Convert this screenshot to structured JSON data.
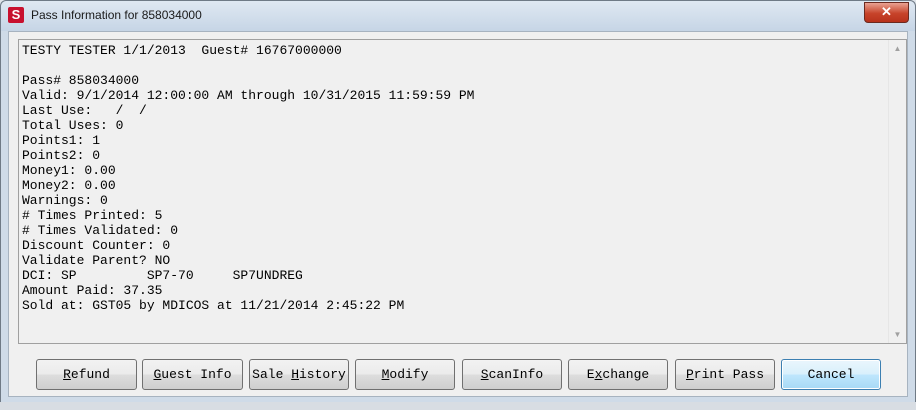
{
  "window": {
    "title": "Pass Information for 858034000",
    "app_icon_letter": "S",
    "close_glyph": "✕"
  },
  "pass_info": {
    "lines": [
      "TESTY TESTER 1/1/2013  Guest# 16767000000",
      "",
      "Pass# 858034000",
      "Valid: 9/1/2014 12:00:00 AM through 10/31/2015 11:59:59 PM",
      "Last Use:   /  /",
      "Total Uses: 0",
      "Points1: 1",
      "Points2: 0",
      "Money1: 0.00",
      "Money2: 0.00",
      "Warnings: 0",
      "# Times Printed: 5",
      "# Times Validated: 0",
      "Discount Counter: 0",
      "Validate Parent? NO",
      "DCI: SP         SP7-70     SP7UNDREG",
      "Amount Paid: 37.35",
      "Sold at: GST05 by MDICOS at 11/21/2014 2:45:22 PM"
    ]
  },
  "scrollbar": {
    "up_glyph": "▲",
    "down_glyph": "▼"
  },
  "buttons": [
    {
      "id": "refund",
      "label": "Refund",
      "accel_index": 0
    },
    {
      "id": "guest-info",
      "label": "Guest Info",
      "accel_index": 0
    },
    {
      "id": "sale-history",
      "label": "Sale History",
      "accel_index": 5
    },
    {
      "id": "modify",
      "label": "Modify",
      "accel_index": 0
    },
    {
      "id": "scaninfo",
      "label": "ScanInfo",
      "accel_index": 0
    },
    {
      "id": "exchange",
      "label": "Exchange",
      "accel_index": 1
    },
    {
      "id": "print-pass",
      "label": "Print Pass",
      "accel_index": 0
    },
    {
      "id": "cancel",
      "label": "Cancel",
      "accel_index": -1,
      "default": true
    }
  ]
}
